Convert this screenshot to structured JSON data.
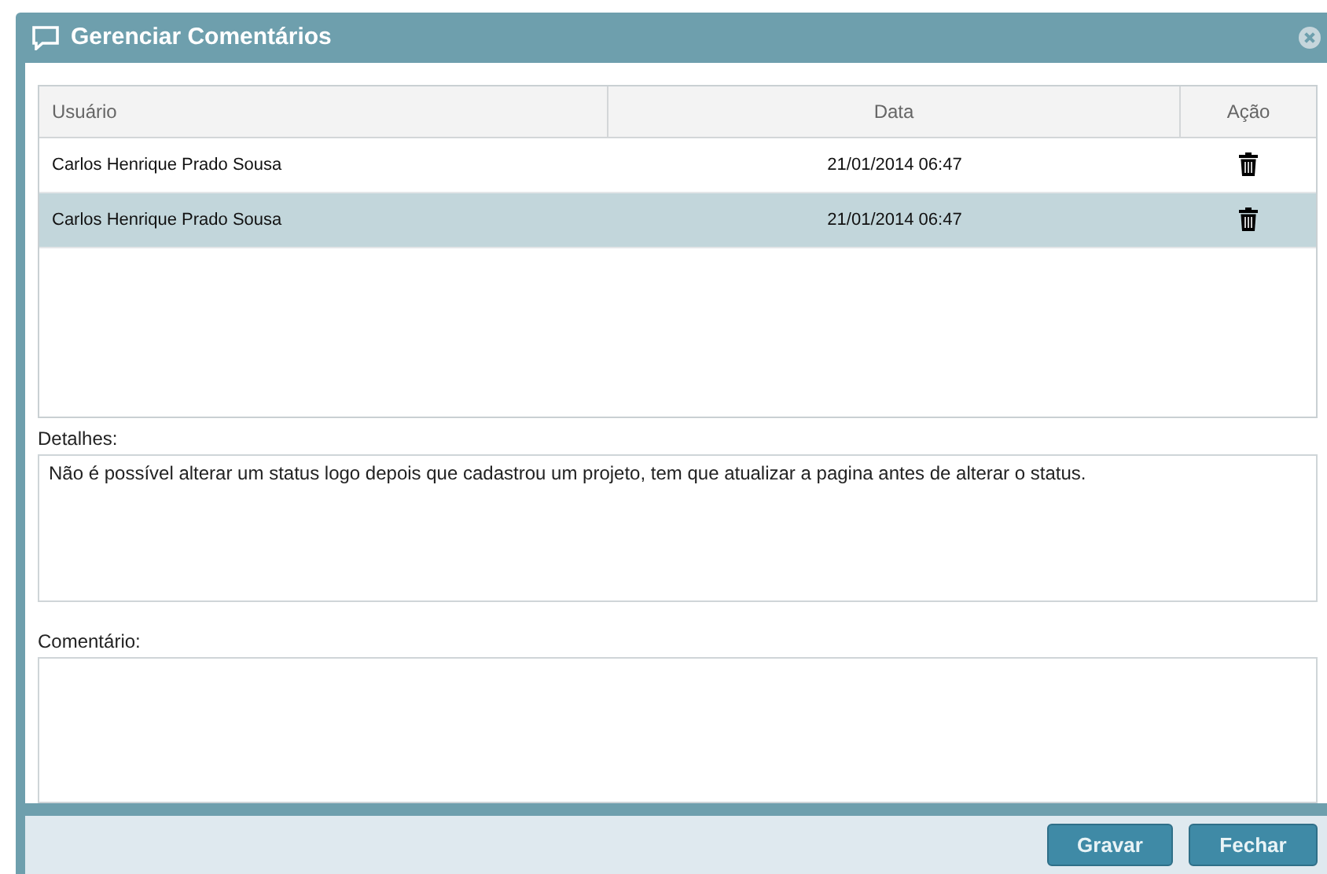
{
  "window": {
    "title": "Gerenciar Comentários"
  },
  "table": {
    "columns": [
      "Usuário",
      "Data",
      "Ação"
    ],
    "rows": [
      {
        "user": "Carlos Henrique Prado Sousa",
        "date": "21/01/2014 06:47",
        "selected": false
      },
      {
        "user": "Carlos Henrique Prado Sousa",
        "date": "21/01/2014 06:47",
        "selected": true
      }
    ]
  },
  "details": {
    "label": "Detalhes:",
    "value": "Não é possível alterar um status logo depois que cadastrou um projeto, tem que atualizar a pagina antes de alterar o status."
  },
  "comment": {
    "label": "Comentário:"
  },
  "buttons": [
    "Gravar",
    "Fechar"
  ]
}
